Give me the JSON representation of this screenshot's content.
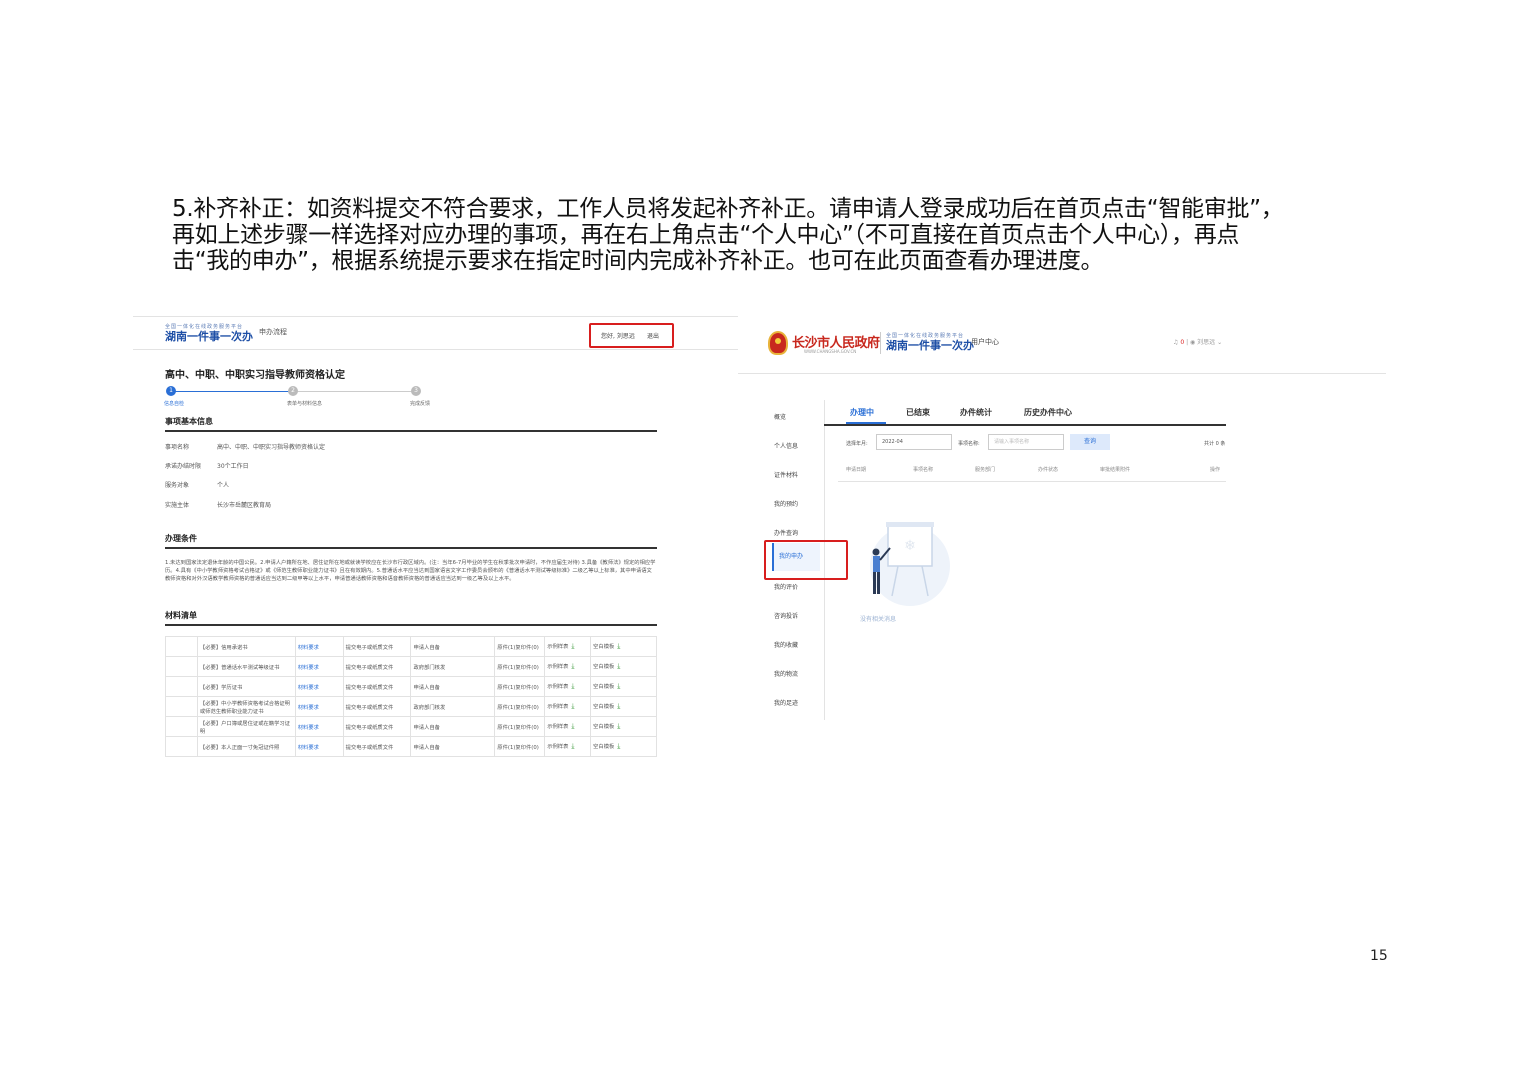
{
  "instruction": {
    "line1": "5.补齐补正：如资料提交不符合要求，工作人员将发起补齐补正。请申请人登录成功后在首页点击“智能审批”，",
    "line2": "再如上述步骤一样选择对应办理的事项，再在右上角点击“个人中心”（不可直接在首页点击个人中心），再点",
    "line3": "击“我的申办”，根据系统提示要求在指定时间内完成补齐补正。也可在此页面查看办理进度。"
  },
  "page_number": "15",
  "left_shot": {
    "logo_small": "全国一体化在线政务服务平台",
    "logo": "湖南一件事一次办",
    "flow_link": "申办流程",
    "greeting": "您好, 刘思远",
    "logout": "退出",
    "title": "高中、中职、中职实习指导教师资格认定",
    "steps": [
      {
        "num": "1",
        "label": "信息自检"
      },
      {
        "num": "2",
        "label": "表单与材料信息"
      },
      {
        "num": "3",
        "label": "完成反馈"
      }
    ],
    "basic_title": "事项基本信息",
    "basic": [
      {
        "k": "事项名称",
        "v": "高中、中职、中职实习指导教师资格认定"
      },
      {
        "k": "承诺办结时限",
        "v": "30个工作日"
      },
      {
        "k": "服务对象",
        "v": "个人"
      },
      {
        "k": "实施主体",
        "v": "长沙市岳麓区教育局"
      }
    ],
    "cond_title": "办理条件",
    "conditions": "1.未达到国家法定退休年龄的中国公民。2.申请人户籍所在地、居住证所在地或就读学校应在长沙市行政区域内。(注：当年6-7月毕业的学生在秋季批次申请时，不作应届生对待) 3.具备《教师法》规定的相应学历。4.具有《中小学教师资格考试合格证》或《师范生教师职业能力证书》且在有效期内。5.普通话水平应当达到国家语言文字工作委员会颁布的《普通话水平测试等级标准》二级乙等以上标准，其中申请语文教师资格和对外汉语教学教师资格的普通话应当达到二级甲等以上水平，申请普通话教师资格和语音教师资格的普通话应当达到一级乙等及以上水平。",
    "mat_title": "材料清单",
    "materials": [
      {
        "name": "【必要】信用承诺书",
        "req": "材料要求",
        "form": "提交电子或纸质文件",
        "src": "申请人自备",
        "count": "原件(1)复印件(0)",
        "sample": "示例样表",
        "blank": "空白模板"
      },
      {
        "name": "【必要】普通话水平测试等级证书",
        "req": "材料要求",
        "form": "提交电子或纸质文件",
        "src": "政府部门核发",
        "count": "原件(1)复印件(0)",
        "sample": "示例样表",
        "blank": "空白模板"
      },
      {
        "name": "【必要】学历证书",
        "req": "材料要求",
        "form": "提交电子或纸质文件",
        "src": "申请人自备",
        "count": "原件(1)复印件(0)",
        "sample": "示例样表",
        "blank": "空白模板"
      },
      {
        "name": "【必要】中小学教师资格考试合格证明或师范生教师职业能力证书",
        "req": "材料要求",
        "form": "提交电子或纸质文件",
        "src": "政府部门核发",
        "count": "原件(1)复印件(0)",
        "sample": "示例样表",
        "blank": "空白模板"
      },
      {
        "name": "【必要】户口簿或居住证或在籍学习证明",
        "req": "材料要求",
        "form": "提交电子或纸质文件",
        "src": "申请人自备",
        "count": "原件(1)复印件(0)",
        "sample": "示例样表",
        "blank": "空白模板"
      },
      {
        "name": "【必要】本人正面一寸免冠证件照",
        "req": "材料要求",
        "form": "提交电子或纸质文件",
        "src": "申请人自备",
        "count": "原件(1)复印件(0)",
        "sample": "示例样表",
        "blank": "空白模板"
      }
    ]
  },
  "right_shot": {
    "gov_name": "长沙市人民政府",
    "gov_url": "WWW.CHANGSHA.GOV.CN",
    "logo_small": "全国一体化在线政务服务平台",
    "logo": "湖南一件事一次办",
    "user_center": "用户中心",
    "notif": "0",
    "user": "刘思远",
    "sidebar": [
      "概览",
      "个人信息",
      "证件材料",
      "我的预约",
      "办件查询",
      "我的申办",
      "我的评价",
      "咨询投诉",
      "我的收藏",
      "我的物流",
      "我的足迹"
    ],
    "tabs": [
      "办理中",
      "已结束",
      "办件统计",
      "历史办件中心"
    ],
    "filter_year_label": "选择年月:",
    "filter_year_value": "2022-04",
    "filter_name_label": "事项名称:",
    "filter_name_placeholder": "请输入事项名称",
    "query_button": "查询",
    "total": "共计 0 条",
    "columns": [
      "申请日期",
      "事项名称",
      "服务部门",
      "办件状态",
      "审批结果附件",
      "操作"
    ],
    "empty_text": "没有相关消息"
  },
  "colors": {
    "highlight": "#d81e1e",
    "accent": "#2a6fd6",
    "brand": "#1e4fa6"
  }
}
